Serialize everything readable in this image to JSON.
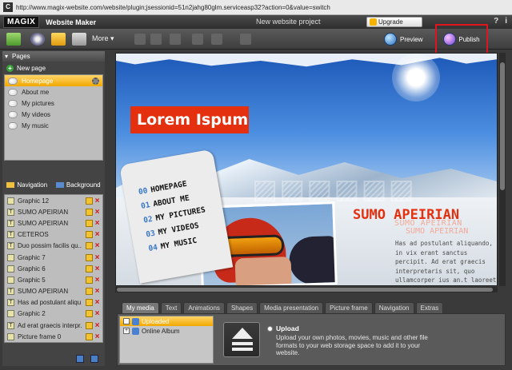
{
  "browser": {
    "favicon": "C",
    "url": "http://www.magix-website.com/website/plugin;jsessionid=51n2jahg80glm.serviceasp32?action=0&value=switch"
  },
  "titlebar": {
    "logo": "MAGIX",
    "app_name": "Website Maker",
    "project_name": "New website project",
    "upgrade_label": "Upgrade",
    "help_label": "?",
    "info_label": "i"
  },
  "toolbar": {
    "more_label": "More",
    "preview_label": "Preview",
    "publish_label": "Publish"
  },
  "left_panel": {
    "pages_header": "Pages",
    "new_page_label": "New page",
    "pages": [
      {
        "label": "Homepage"
      },
      {
        "label": "About me"
      },
      {
        "label": "My pictures"
      },
      {
        "label": "My videos"
      },
      {
        "label": "My music"
      }
    ],
    "navigation_label": "Navigation",
    "background_label": "Background",
    "elements": [
      {
        "label": "Graphic 12",
        "icon": "G"
      },
      {
        "label": "SUMO APEIRIAN",
        "icon": "T"
      },
      {
        "label": "SUMO APEIRIAN",
        "icon": "T"
      },
      {
        "label": "CETEROS",
        "icon": "T"
      },
      {
        "label": "Duo possim facilis qu...",
        "icon": "T"
      },
      {
        "label": "Graphic 7",
        "icon": "G"
      },
      {
        "label": "Graphic 6",
        "icon": "G"
      },
      {
        "label": "Graphic 5",
        "icon": "G"
      },
      {
        "label": "SUMO APEIRIAN",
        "icon": "T"
      },
      {
        "label": "Has ad postulant aliqu...",
        "icon": "T"
      },
      {
        "label": "Graphic 2",
        "icon": "G"
      },
      {
        "label": "Ad erat graecis interpr...",
        "icon": "T"
      },
      {
        "label": "Picture frame 0",
        "icon": "G"
      }
    ]
  },
  "canvas": {
    "headline": "Lorem Ispum",
    "nav_items": [
      {
        "num": "00",
        "label": "HOMEPAGE"
      },
      {
        "num": "01",
        "label": "ABOUT ME"
      },
      {
        "num": "02",
        "label": "MY PICTURES"
      },
      {
        "num": "03",
        "label": "MY VIDEOS"
      },
      {
        "num": "04",
        "label": "MY MUSIC"
      }
    ],
    "sumo_title": "SUMO APEIRIAN",
    "sumo_echo_1": "SUMO APEIRIAN",
    "sumo_echo_2": "SUMO APEIRIAN",
    "body_text": "Has ad postulant aliquando, in vix erant sanctus percipit. Ad erat graecis interpretaris sit, quo ullamcorper ius an.t laoreet"
  },
  "bottom": {
    "tabs": [
      {
        "label": "My media"
      },
      {
        "label": "Text"
      },
      {
        "label": "Animations"
      },
      {
        "label": "Shapes"
      },
      {
        "label": "Media presentation"
      },
      {
        "label": "Picture frame"
      },
      {
        "label": "Navigation"
      },
      {
        "label": "Extras"
      }
    ],
    "tree": [
      {
        "label": "Uploaded"
      },
      {
        "label": "Online Album"
      }
    ],
    "upload_title": "Upload",
    "upload_desc": "Upload your own photos, movies, music and other file formats to your web storage space to add it to your website."
  },
  "colors": {
    "accent": "#f2a800",
    "highlight_box": "#e0141e",
    "headline_bg": "#e4300e"
  }
}
